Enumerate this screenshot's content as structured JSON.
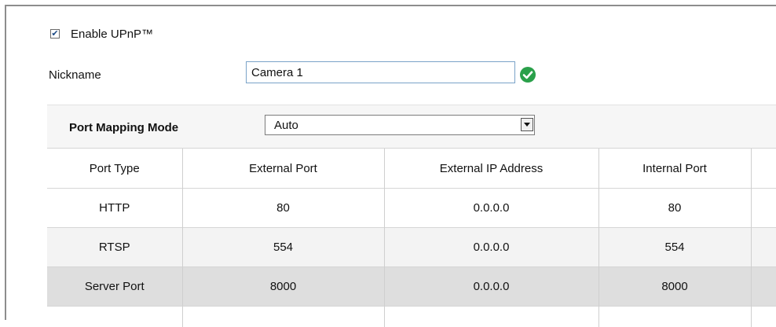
{
  "upnp": {
    "label": "Enable UPnP™",
    "checked": true,
    "check_glyph": "✔"
  },
  "nickname": {
    "label": "Nickname",
    "value": "Camera 1",
    "status_icon": "check-circle-icon",
    "status_color": "#2aa04a"
  },
  "port_mapping": {
    "label": "Port Mapping Mode",
    "selected": "Auto"
  },
  "table": {
    "headers": [
      "Port Type",
      "External Port",
      "External IP Address",
      "Internal Port",
      ""
    ],
    "rows": [
      {
        "cells": [
          "HTTP",
          "80",
          "0.0.0.0",
          "80",
          ""
        ]
      },
      {
        "cells": [
          "RTSP",
          "554",
          "0.0.0.0",
          "554",
          ""
        ]
      },
      {
        "cells": [
          "Server Port",
          "8000",
          "0.0.0.0",
          "8000",
          ""
        ]
      },
      {
        "cells": [
          "",
          "",
          "",
          "",
          ""
        ]
      }
    ]
  },
  "colors": {
    "accent_border": "#7aa3c8",
    "selected_row": "#dedede",
    "alt_row": "#f3f3f3"
  }
}
